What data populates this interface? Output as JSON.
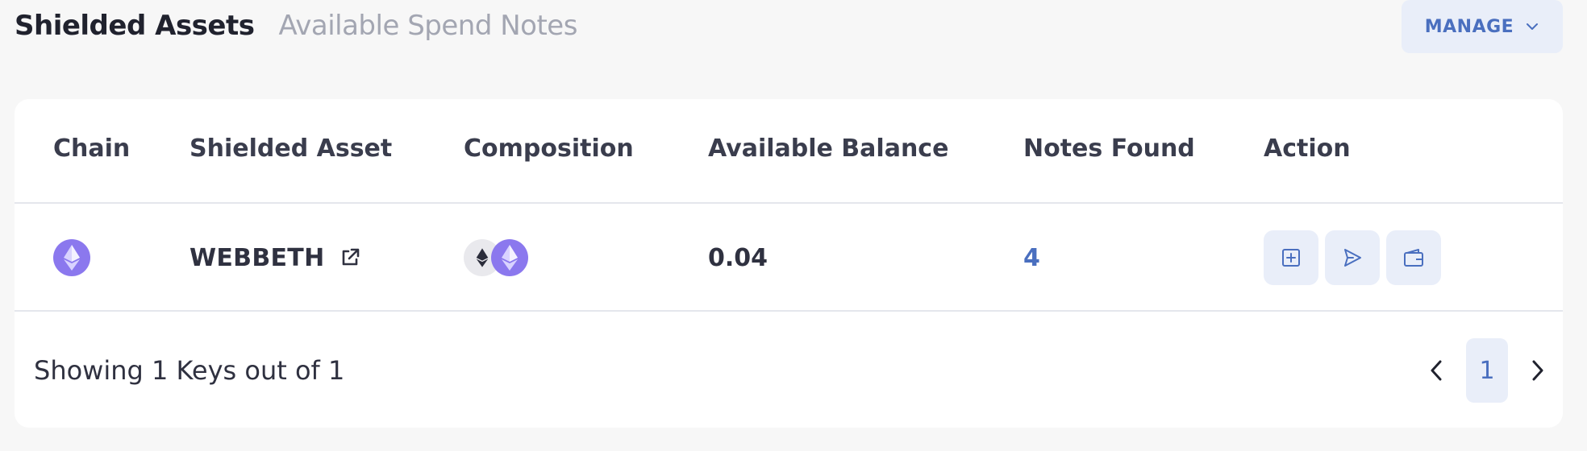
{
  "header": {
    "tabs": [
      {
        "label": "Shielded Assets",
        "active": true
      },
      {
        "label": "Available Spend Notes",
        "active": false
      }
    ],
    "manage_label": "MANAGE"
  },
  "table": {
    "columns": [
      "Chain",
      "Shielded Asset",
      "Composition",
      "Available Balance",
      "Notes Found",
      "Action"
    ],
    "rows": [
      {
        "chain_icon": "ethereum-icon",
        "asset": "WEBBETH",
        "composition": [
          "ethereum-icon",
          "ethereum-icon"
        ],
        "balance": "0.04",
        "notes_found": "4",
        "actions": [
          "deposit-icon",
          "transfer-icon",
          "withdraw-icon"
        ]
      }
    ]
  },
  "footer": {
    "showing_text": "Showing 1 Keys out of 1",
    "current_page": "1"
  },
  "colors": {
    "background": "#f7f7f7",
    "card": "#ffffff",
    "accent": "#4a6fbf",
    "accent_soft": "#e9eef9",
    "eth_purple": "#8b78ee",
    "text_dark": "#2f3140",
    "text_muted": "#a3a6b2"
  }
}
